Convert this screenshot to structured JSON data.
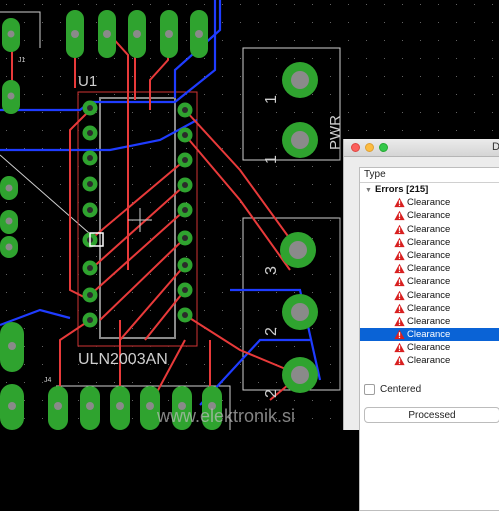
{
  "board": {
    "labels": {
      "u1": "U1",
      "chip": "ULN2003AN",
      "pwr": "PWR",
      "j1": "J1",
      "j4": "J4",
      "watermark": "www.elektronik.si",
      "pin1": "1",
      "pin2": "2",
      "pin3": "3",
      "pin2b": "2",
      "pin1b": "1"
    }
  },
  "dialog": {
    "title": "D",
    "column_header": "Type",
    "group": "Errors [215]",
    "items": [
      "Clearance",
      "Clearance",
      "Clearance",
      "Clearance",
      "Clearance",
      "Clearance",
      "Clearance",
      "Clearance",
      "Clearance",
      "Clearance",
      "Clearance",
      "Clearance",
      "Clearance"
    ],
    "selected_index": 10,
    "centered_label": "Centered",
    "centered_checked": false,
    "status_button": "Processed"
  }
}
